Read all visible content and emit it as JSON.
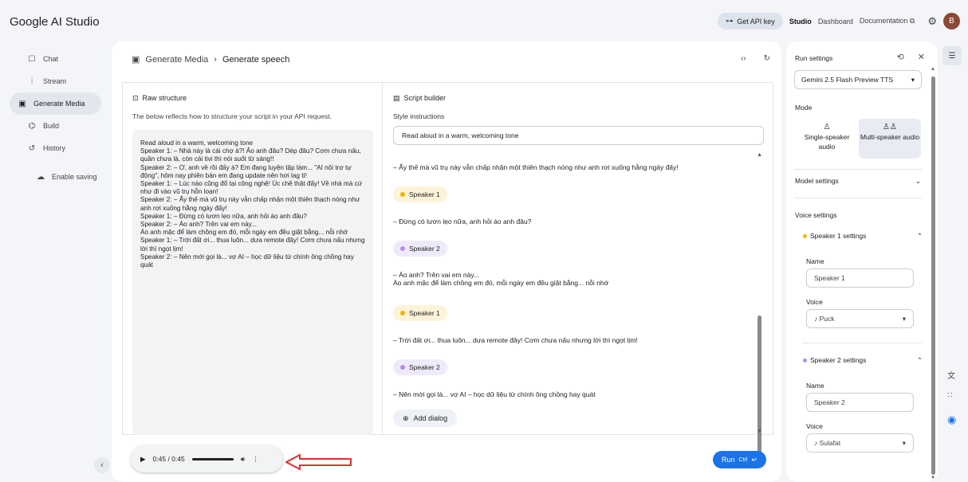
{
  "header": {
    "logo": "Google AI Studio",
    "api_key_label": "Get API key",
    "nav": [
      "Studio",
      "Dashboard",
      "Documentation"
    ],
    "avatar_letter": "B"
  },
  "sidebar": {
    "items": [
      {
        "label": "Chat",
        "icon": "chat-icon"
      },
      {
        "label": "Stream",
        "icon": "stream-icon"
      },
      {
        "label": "Generate Media",
        "icon": "media-icon"
      },
      {
        "label": "Build",
        "icon": "build-icon"
      },
      {
        "label": "History",
        "icon": "history-icon"
      }
    ],
    "active_index": 2,
    "enable_saving": "Enable saving"
  },
  "breadcrumb": {
    "parent": "Generate Media",
    "current": "Generate speech"
  },
  "raw": {
    "title": "Raw structure",
    "desc": "The below reflects how to structure your script in your API request.",
    "content": "Read aloud in a warm, welcoming tone\nSpeaker 1: – Nhà này là cái chợ à?! Ảo anh đâu? Dép đâu? Cơm chưa nấu, quần chưa là, còn cái tivi thì nói suốt từ sáng!!\nSpeaker 2: – Ơ, anh về rồi đấy à? Em đang luyện tập làm... \"AI nội trợ tự động\", hôm nay phiên bản em đang update nên hơi lag tí!\nSpeaker 1: – Lúc nào cũng đổ tại công nghệ! Úc chế thật đấy! Về nhà mà cứ như đi vào vũ trụ hỗn loạn!\nSpeaker 2: – Ấy thế mà vũ trụ này vẫn chấp nhận một thiên thạch nóng như anh rơi xuống hằng ngày đấy!\nSpeaker 1: – Đừng có lươn lẹo nữa, anh hỏi áo anh đâu?\nSpeaker 2: – Áo anh? Trên vai em này...\nÁo anh mặc để làm chồng em đó, mỗi ngày em đều giặt bằng... nỗi nhớ\nSpeaker 1: – Trời đất ơi... thua luôn... dưa remote đây! Cơm chưa nấu nhưng lời thì ngọt lịm!\nSpeaker 2: – Nên mới gọi là... vợ AI – học dữ liệu từ chính ông chồng hay quát"
  },
  "script": {
    "title": "Script builder",
    "style_label": "Style instructions",
    "style_value": "Read aloud in a warm, welcoming tone",
    "dialogs": [
      {
        "type": "text",
        "text": "– Ấy thế mà vũ trụ này vẫn chấp nhận một thiên thạch nóng như anh rơi xuống hằng ngày đấy!"
      },
      {
        "type": "speaker",
        "speaker": 1,
        "text": "Speaker 1"
      },
      {
        "type": "text",
        "text": "– Đừng có lươn lẹo nữa, anh hỏi áo anh đâu?"
      },
      {
        "type": "speaker",
        "speaker": 2,
        "text": "Speaker 2"
      },
      {
        "type": "text",
        "text": "– Áo anh? Trên vai em này...\nÁo anh mặc để làm chồng em đó, mỗi ngày em đều giặt bằng... nỗi nhớ"
      },
      {
        "type": "speaker",
        "speaker": 1,
        "text": "Speaker 1"
      },
      {
        "type": "text",
        "text": "– Trời đất ơi... thua luôn... dưa remote đây! Cơm chưa nấu nhưng lời thì ngọt lịm!"
      },
      {
        "type": "speaker",
        "speaker": 2,
        "text": "Speaker 2"
      },
      {
        "type": "text",
        "text": "– Nên mới gọi là... vợ AI – học dữ liệu từ chính ông chồng hay quát"
      }
    ],
    "add_dialog": "Add dialog"
  },
  "player": {
    "time": "0:45 / 0:45"
  },
  "run": {
    "label": "Run",
    "shortcut": "Ctrl"
  },
  "settings": {
    "title": "Run settings",
    "model": "Gemini 2.5 Flash Preview TTS",
    "mode_label": "Mode",
    "modes": [
      "Single-speaker audio",
      "Multi-speaker audio"
    ],
    "active_mode": 1,
    "model_settings": "Model settings",
    "voice_settings": "Voice settings",
    "speakers": [
      {
        "title": "Speaker 1 settings",
        "name_label": "Name",
        "name": "Speaker 1",
        "voice_label": "Voice",
        "voice": "Puck",
        "color": "#f0b400"
      },
      {
        "title": "Speaker 2 settings",
        "name_label": "Name",
        "name": "Speaker 2",
        "voice_label": "Voice",
        "voice": "Sulafat",
        "color": "#b48df0"
      }
    ]
  },
  "colors": {
    "accent": "#1a73e8",
    "annotation_arrow": "#e03030"
  }
}
